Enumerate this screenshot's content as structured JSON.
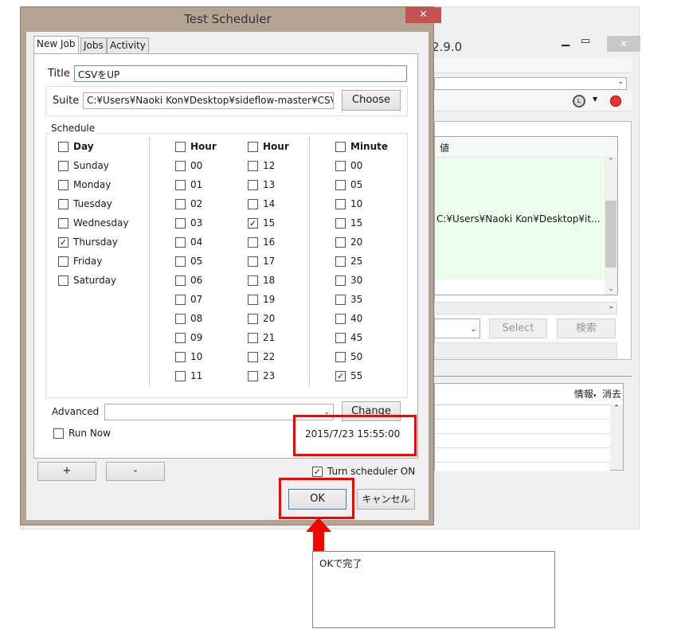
{
  "background_window": {
    "title_fragment": "2.9.0",
    "grid_header": "値",
    "grid_value": "C:¥Users¥Naoki Kon¥Desktop¥it...",
    "select_button": "Select",
    "search_button": "検索",
    "log_info": "情報",
    "log_clear": "消去"
  },
  "dialog": {
    "title": "Test Scheduler",
    "tabs": [
      "New Job",
      "Jobs",
      "Activity"
    ],
    "title_label": "Title",
    "title_value": "CSVをUP",
    "suite_label": "Suite",
    "suite_value": "C:¥Users¥Naoki Kon¥Desktop¥sideflow-master¥CSV",
    "choose_button": "Choose",
    "schedule_label": "Schedule",
    "day_header": "Day",
    "days": [
      {
        "label": "Sunday",
        "checked": false
      },
      {
        "label": "Monday",
        "checked": false
      },
      {
        "label": "Tuesday",
        "checked": false
      },
      {
        "label": "Wednesday",
        "checked": false
      },
      {
        "label": "Thursday",
        "checked": true
      },
      {
        "label": "Friday",
        "checked": false
      },
      {
        "label": "Saturday",
        "checked": false
      }
    ],
    "hour_header": "Hour",
    "hours_a": [
      {
        "label": "00"
      },
      {
        "label": "01"
      },
      {
        "label": "02"
      },
      {
        "label": "03"
      },
      {
        "label": "04"
      },
      {
        "label": "05"
      },
      {
        "label": "06"
      },
      {
        "label": "07"
      },
      {
        "label": "08"
      },
      {
        "label": "09"
      },
      {
        "label": "10"
      },
      {
        "label": "11"
      }
    ],
    "hours_b": [
      {
        "label": "12"
      },
      {
        "label": "13"
      },
      {
        "label": "14"
      },
      {
        "label": "15",
        "checked": true
      },
      {
        "label": "16"
      },
      {
        "label": "17"
      },
      {
        "label": "18"
      },
      {
        "label": "19"
      },
      {
        "label": "20"
      },
      {
        "label": "21"
      },
      {
        "label": "22"
      },
      {
        "label": "23"
      }
    ],
    "minute_header": "Minute",
    "minutes": [
      {
        "label": "00"
      },
      {
        "label": "05"
      },
      {
        "label": "10"
      },
      {
        "label": "15"
      },
      {
        "label": "20"
      },
      {
        "label": "25"
      },
      {
        "label": "30"
      },
      {
        "label": "35"
      },
      {
        "label": "40"
      },
      {
        "label": "45"
      },
      {
        "label": "50"
      },
      {
        "label": "55",
        "checked": true
      }
    ],
    "advanced_label": "Advanced",
    "advanced_value": "",
    "change_button": "Change",
    "run_now_label": "Run Now",
    "next_run": "2015/7/23 15:55:00",
    "plus_button": "+",
    "minus_button": "-",
    "scheduler_on_label": "Turn scheduler ON",
    "scheduler_on": true,
    "ok_button": "OK",
    "cancel_button": "キャンセル"
  },
  "annotation": {
    "callout_text": "OKで完了",
    "highlight_color": "#ff0000"
  }
}
